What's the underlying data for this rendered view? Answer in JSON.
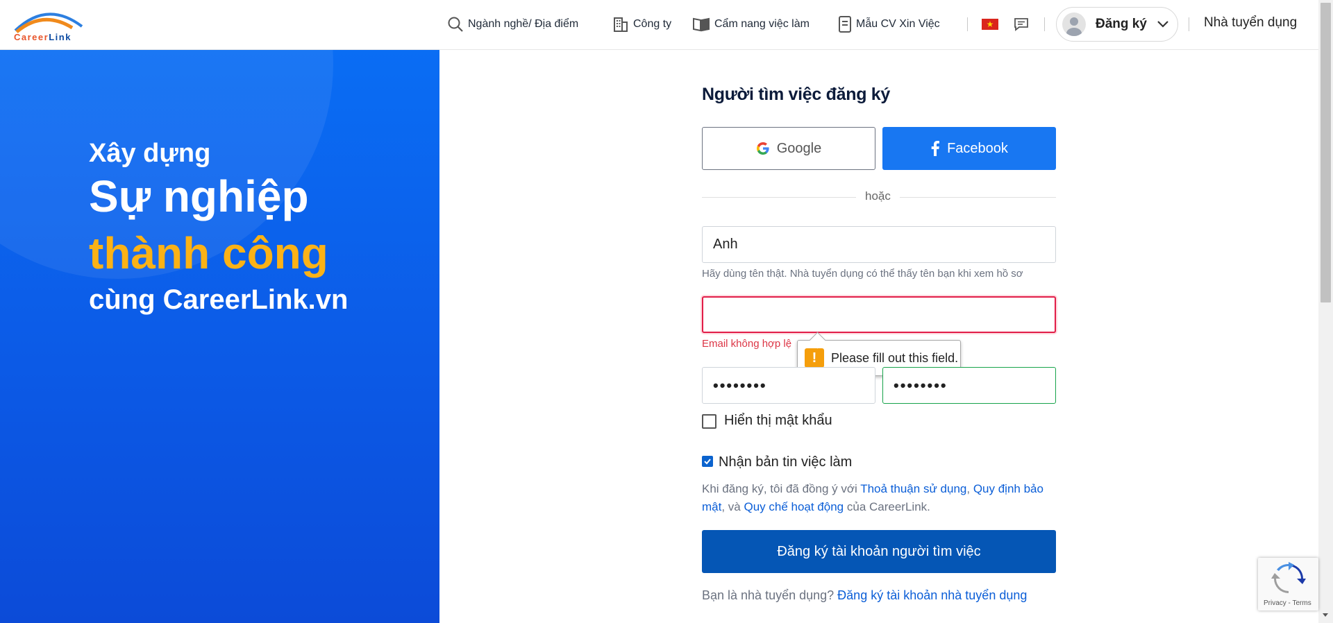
{
  "header": {
    "logo_text_a": "Career",
    "logo_text_b": "Link",
    "nav": {
      "industry_location": "Ngành nghề/ Địa điểm",
      "company": "Công ty",
      "handbook": "Cẩm nang việc làm",
      "cv_template": "Mẫu CV Xin Việc"
    },
    "language_flag": "vietnam-flag-icon",
    "signup_label": "Đăng ký",
    "employer_link": "Nhà tuyển dụng"
  },
  "hero": {
    "line1": "Xây dựng",
    "line2": "Sự nghiệp",
    "line3": "thành công",
    "line4": "cùng CareerLink.vn"
  },
  "form": {
    "title": "Người tìm việc đăng ký",
    "google_label": "Google",
    "facebook_label": "Facebook",
    "or_text": "hoặc",
    "name_value": "Anh",
    "name_hint": "Hãy dùng tên thật. Nhà tuyển dụng có thể thấy tên bạn khi xem hồ sơ",
    "email_value": "",
    "email_error": "Email không hợp lệ",
    "tooltip_text": "Please fill out this field.",
    "password_dots": "••••••••",
    "confirm_password_dots": "••••••••",
    "show_password_label": "Hiển thị mật khẩu",
    "newsletter_label": "Nhận bản tin việc làm",
    "newsletter_checked": true,
    "terms_prefix": "Khi đăng ký, tôi đã đồng ý với ",
    "terms_link1": "Thoả thuận sử dụng",
    "terms_sep1": ", ",
    "terms_link2": "Quy định bảo mật",
    "terms_sep2": ", và ",
    "terms_link3": "Quy chế hoạt động",
    "terms_suffix": " của CareerLink.",
    "submit_label": "Đăng ký tài khoản người tìm việc",
    "employer_prompt": "Bạn là nhà tuyển dụng? ",
    "employer_signup_link": "Đăng ký tài khoản nhà tuyển dụng"
  },
  "recaptcha": {
    "text": "Privacy - Terms"
  },
  "colors": {
    "accent_blue": "#0556b5",
    "facebook_blue": "#1877f2",
    "hero_yellow": "#fbb216",
    "error_red": "#dc3545"
  }
}
